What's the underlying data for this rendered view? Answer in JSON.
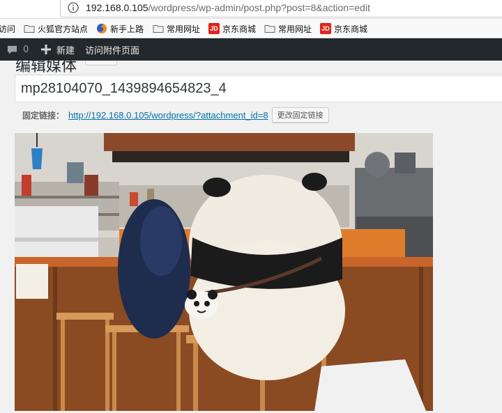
{
  "browser": {
    "url_host": "192.168.0.105",
    "url_path": "/wordpress/wp-admin/post.php?post=8&action=edit"
  },
  "bookmarks": [
    {
      "label": "访问",
      "icon": "none"
    },
    {
      "label": "火狐官方站点",
      "icon": "folder-icon"
    },
    {
      "label": "新手上路",
      "icon": "firefox-icon"
    },
    {
      "label": "常用网址",
      "icon": "folder-icon"
    },
    {
      "label": "京东商城",
      "icon": "jd-icon"
    },
    {
      "label": "常用网址",
      "icon": "folder-icon"
    },
    {
      "label": "京东商城",
      "icon": "jd-icon"
    }
  ],
  "jd_badge": "JD",
  "adminbar": {
    "comments_count": "0",
    "new_label": "新建",
    "view_label": "访问附件页面"
  },
  "page": {
    "heading_partial": "编辑媒体",
    "title_value": "mp28104070_1439894654823_4",
    "permalink_label": "固定链接：",
    "permalink_url": "http://192.168.0.105/wordpress/?attachment_id=8",
    "change_permalink_button": "更改固定链接"
  },
  "colors": {
    "adminbar_bg": "#23282d",
    "link": "#0073aa",
    "page_bg": "#f1f1f1"
  }
}
